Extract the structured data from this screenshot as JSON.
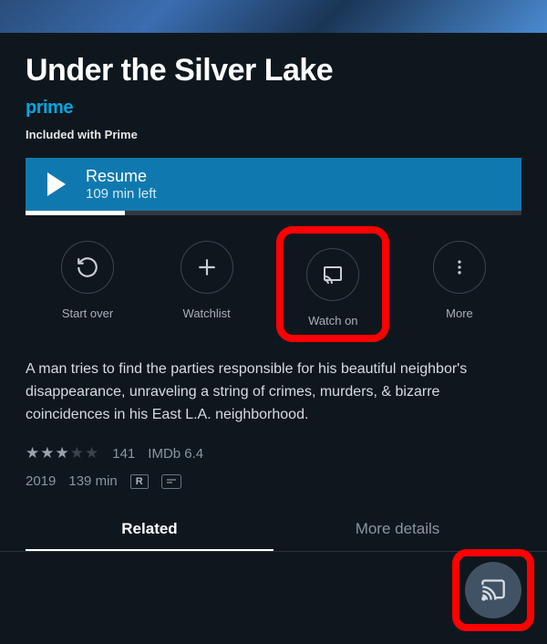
{
  "title": "Under the Silver Lake",
  "prime_label": "prime",
  "included_label": "Included with Prime",
  "resume": {
    "label": "Resume",
    "time_left": "109 min left",
    "progress_pct": 20
  },
  "actions": {
    "start_over": "Start over",
    "watchlist": "Watchlist",
    "watch_on": "Watch on",
    "more": "More"
  },
  "synopsis": "A man tries to find the parties responsible for his beautiful neighbor's disappearance, unraveling a string of crimes, murders, & bizarre coincidences in his East L.A. neighborhood.",
  "rating": {
    "stars_filled": 3,
    "stars_total": 5,
    "count": "141",
    "imdb": "IMDb 6.4"
  },
  "meta": {
    "year": "2019",
    "runtime": "139 min",
    "mpaa": "R"
  },
  "tabs": {
    "related": "Related",
    "more_details": "More details"
  }
}
